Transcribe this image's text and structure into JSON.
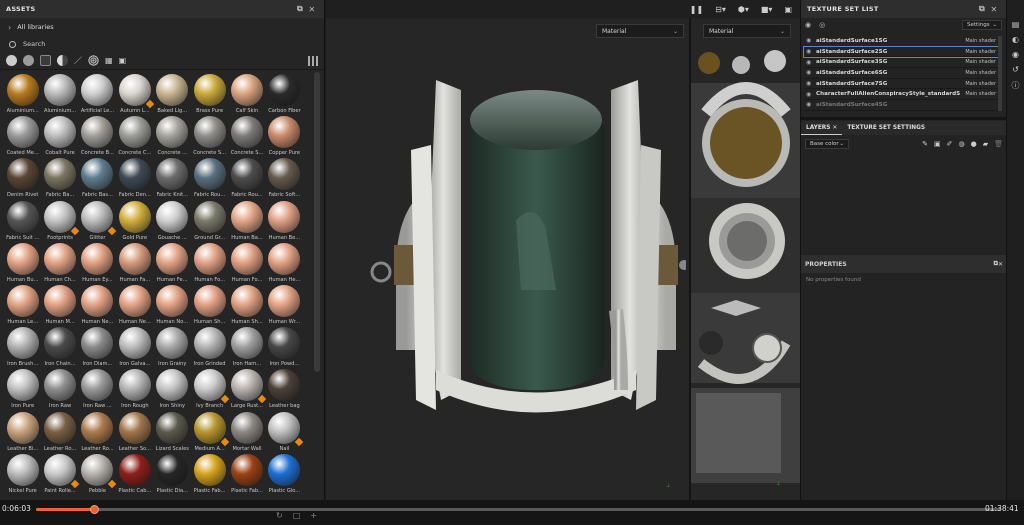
{
  "assets": {
    "title": "ASSETS",
    "library": "All libraries",
    "search_placeholder": "Search",
    "items": [
      {
        "label": "Aluminium...",
        "color": "#b77a1f",
        "badge": false
      },
      {
        "label": "Aluminium...",
        "color": "#b9b9b9",
        "badge": false
      },
      {
        "label": "Artificial Le...",
        "color": "#cfcfcf",
        "badge": false
      },
      {
        "label": "Autumn L...",
        "color": "#d9d4ce",
        "badge": true
      },
      {
        "label": "Baked Lig...",
        "color": "#c8b491",
        "badge": false
      },
      {
        "label": "Brass Pure",
        "color": "#c9a93a",
        "badge": false
      },
      {
        "label": "Calf Skin",
        "color": "#d9a37f",
        "badge": false
      },
      {
        "label": "Carbon Fiber",
        "color": "#2a2a2a",
        "badge": false
      },
      {
        "label": "Coated Me...",
        "color": "#9a9a9a",
        "badge": false
      },
      {
        "label": "Cobalt Pure",
        "color": "#bdbdbd",
        "badge": false
      },
      {
        "label": "Concrete B...",
        "color": "#a19e98",
        "badge": false
      },
      {
        "label": "Concrete C...",
        "color": "#9c9c98",
        "badge": false
      },
      {
        "label": "Concrete ...",
        "color": "#a6a39d",
        "badge": false
      },
      {
        "label": "Concrete S...",
        "color": "#8f8d89",
        "badge": false
      },
      {
        "label": "Concrete S...",
        "color": "#7d7b78",
        "badge": false
      },
      {
        "label": "Copper Pure",
        "color": "#c98a6a",
        "badge": false
      },
      {
        "label": "Denim Rivet",
        "color": "#5a4634",
        "badge": false
      },
      {
        "label": "Fabric Ba...",
        "color": "#7a7461",
        "badge": false
      },
      {
        "label": "Fabric Bas...",
        "color": "#5f7d8e",
        "badge": false
      },
      {
        "label": "Fabric Den...",
        "color": "#3f4a55",
        "badge": false
      },
      {
        "label": "Fabric Knit...",
        "color": "#6c6c6c",
        "badge": false
      },
      {
        "label": "Fabric Rou...",
        "color": "#5a6f80",
        "badge": false
      },
      {
        "label": "Fabric Rou...",
        "color": "#4d4d4d",
        "badge": false
      },
      {
        "label": "Fabric Soft...",
        "color": "#665a4e",
        "badge": false
      },
      {
        "label": "Fabric Suit ...",
        "color": "#555555",
        "badge": false
      },
      {
        "label": "Footprints",
        "color": "#c4c4c4",
        "badge": true
      },
      {
        "label": "Glitter",
        "color": "#bcbcbc",
        "badge": true
      },
      {
        "label": "Gold Pure",
        "color": "#d2ad3c",
        "badge": false
      },
      {
        "label": "Gouache ...",
        "color": "#cfcfcf",
        "badge": false
      },
      {
        "label": "Ground Gr...",
        "color": "#7a7a6a",
        "badge": false
      },
      {
        "label": "Human Ba...",
        "color": "#e4a587",
        "badge": false
      },
      {
        "label": "Human Be...",
        "color": "#e0a085",
        "badge": false
      },
      {
        "label": "Human Bu...",
        "color": "#e2a184",
        "badge": false
      },
      {
        "label": "Human Ch...",
        "color": "#e3a285",
        "badge": false
      },
      {
        "label": "Human Ey...",
        "color": "#e1a083",
        "badge": false
      },
      {
        "label": "Human Fa...",
        "color": "#d69a7c",
        "badge": false
      },
      {
        "label": "Human Fe...",
        "color": "#e3a284",
        "badge": false
      },
      {
        "label": "Human Fo...",
        "color": "#e2a184",
        "badge": false
      },
      {
        "label": "Human Fo...",
        "color": "#e1a083",
        "badge": false
      },
      {
        "label": "Human He...",
        "color": "#e2a185",
        "badge": false
      },
      {
        "label": "Human Le...",
        "color": "#e2a184",
        "badge": false
      },
      {
        "label": "Human M...",
        "color": "#e1a083",
        "badge": false
      },
      {
        "label": "Human Ne...",
        "color": "#e2a184",
        "badge": false
      },
      {
        "label": "Human Ne...",
        "color": "#e3a285",
        "badge": false
      },
      {
        "label": "Human No...",
        "color": "#e2a184",
        "badge": false
      },
      {
        "label": "Human Sh...",
        "color": "#e1a083",
        "badge": false
      },
      {
        "label": "Human Sh...",
        "color": "#e2a184",
        "badge": false
      },
      {
        "label": "Human Wr...",
        "color": "#e3a285",
        "badge": false
      },
      {
        "label": "Iron Brush...",
        "color": "#b2b2b2",
        "badge": false
      },
      {
        "label": "Iron Chain...",
        "color": "#4a4a4a",
        "badge": false
      },
      {
        "label": "Iron Diam...",
        "color": "#8a8a8a",
        "badge": false
      },
      {
        "label": "Iron Galva...",
        "color": "#bdbdbd",
        "badge": false
      },
      {
        "label": "Iron Grainy",
        "color": "#a9a9a9",
        "badge": false
      },
      {
        "label": "Iron Grinded",
        "color": "#b4b4b4",
        "badge": false
      },
      {
        "label": "Iron Ham...",
        "color": "#a0a0a0",
        "badge": false
      },
      {
        "label": "Iron Powd...",
        "color": "#474747",
        "badge": false
      },
      {
        "label": "Iron Pure",
        "color": "#c1c1c1",
        "badge": false
      },
      {
        "label": "Iron Raw",
        "color": "#8e8e8e",
        "badge": false
      },
      {
        "label": "Iron Raw ...",
        "color": "#9a9a9a",
        "badge": false
      },
      {
        "label": "Iron Rough",
        "color": "#b5b5b5",
        "badge": false
      },
      {
        "label": "Iron Shiny",
        "color": "#c5c5c5",
        "badge": false
      },
      {
        "label": "Ivy Branch",
        "color": "#cccccc",
        "badge": true
      },
      {
        "label": "Large Rust...",
        "color": "#b9b3ae",
        "badge": true
      },
      {
        "label": "Leather bag",
        "color": "#4c4039",
        "badge": false
      },
      {
        "label": "Leather Bi...",
        "color": "#c9a27d",
        "badge": false
      },
      {
        "label": "Leather Ro...",
        "color": "#7a5e46",
        "badge": false
      },
      {
        "label": "Leather Ro...",
        "color": "#ad7a4d",
        "badge": false
      },
      {
        "label": "Leather So...",
        "color": "#a3754b",
        "badge": false
      },
      {
        "label": "Lizard Scales",
        "color": "#5a5a4d",
        "badge": false
      },
      {
        "label": "Medium A...",
        "color": "#b8962f",
        "badge": true
      },
      {
        "label": "Mortar Wall",
        "color": "#8c8782",
        "badge": false
      },
      {
        "label": "Nail",
        "color": "#c0c0c0",
        "badge": true
      },
      {
        "label": "Nickel Pure",
        "color": "#bcbcbc",
        "badge": false
      },
      {
        "label": "Paint Rolle...",
        "color": "#c9c9c9",
        "badge": true
      },
      {
        "label": "Pebble",
        "color": "#b7b3ae",
        "badge": true
      },
      {
        "label": "Plastic Cab...",
        "color": "#8e1f1a",
        "badge": false
      },
      {
        "label": "Plastic Dia...",
        "color": "#262626",
        "badge": false
      },
      {
        "label": "Plastic Fab...",
        "color": "#d6a31f",
        "badge": false
      },
      {
        "label": "Plastic Fab...",
        "color": "#9a4216",
        "badge": false
      },
      {
        "label": "Plastic Glo...",
        "color": "#1e6fd1",
        "badge": false
      }
    ]
  },
  "viewport": {
    "material_dropdown_3d": "Material",
    "material_dropdown_uv": "Material"
  },
  "texture_set_list": {
    "title": "TEXTURE SET LIST",
    "settings_label": "Settings",
    "rows": [
      {
        "name": "aiStandardSurface1SG",
        "shader": "Main shader",
        "state": ""
      },
      {
        "name": "aiStandardSurface2SG",
        "shader": "Main shader",
        "state": "active"
      },
      {
        "name": "aiStandardSurface3SG",
        "shader": "Main shader",
        "state": ""
      },
      {
        "name": "aiStandardSurface6SG",
        "shader": "Main shader",
        "state": ""
      },
      {
        "name": "aiStandardSurface7SG",
        "shader": "Main shader",
        "state": ""
      },
      {
        "name": "CharacterFullAlienConspiracyStyle_standardS",
        "shader": "Main shader",
        "state": ""
      },
      {
        "name": "aiStandardSurface4SG",
        "shader": "",
        "state": "dim"
      }
    ]
  },
  "layers": {
    "tab_layers": "LAYERS",
    "tab_settings": "TEXTURE SET SETTINGS",
    "channel": "Base color"
  },
  "properties": {
    "title": "PROPERTIES",
    "empty_text": "No properties found"
  },
  "player": {
    "current_time": "0:06:03",
    "total_time": "01:38:41",
    "progress": 0.06
  }
}
